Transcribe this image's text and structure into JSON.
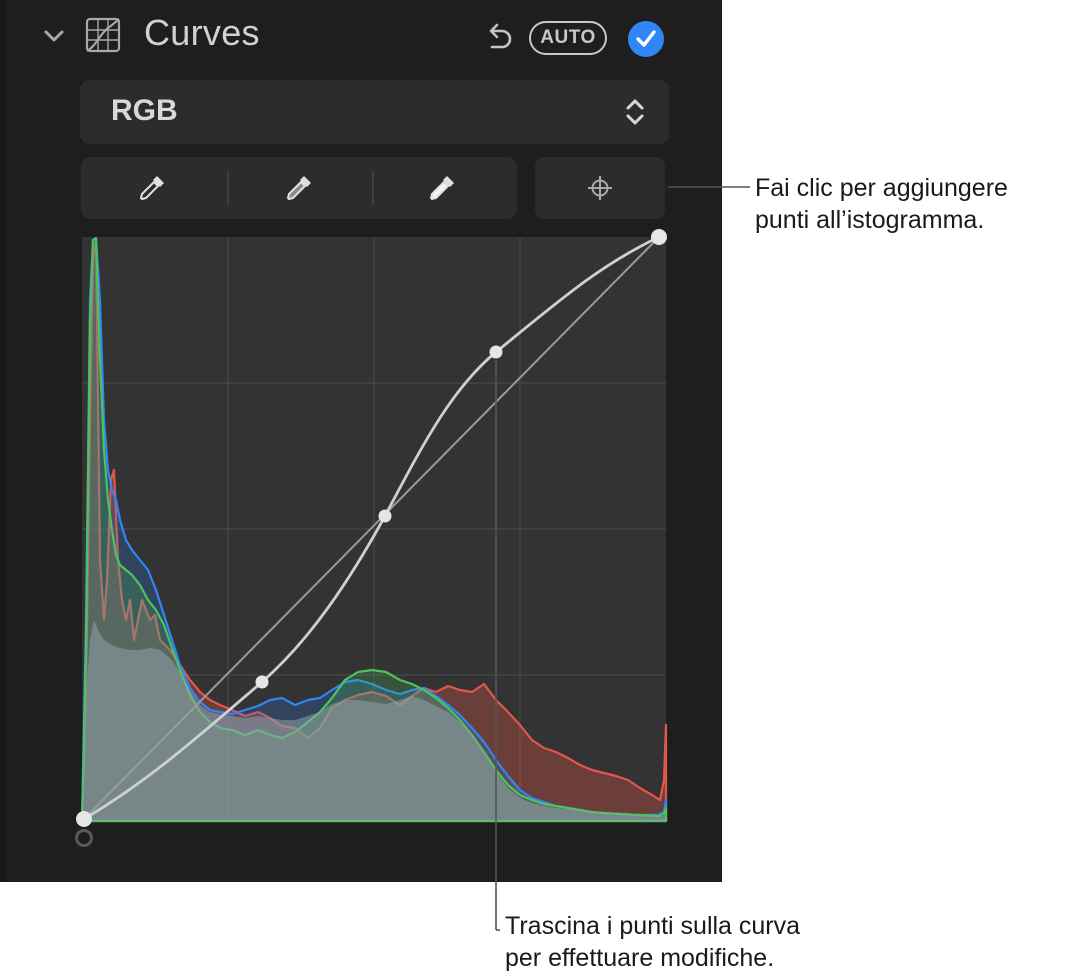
{
  "header": {
    "title": "Curves",
    "auto_label": "AUTO"
  },
  "channel_select": {
    "value": "RGB"
  },
  "callouts": {
    "add_points": {
      "line1": "Fai clic per aggiungere",
      "line2": "punti all’istogramma."
    },
    "drag_points": {
      "line1": "Trascina i punti sulla curva",
      "line2": "per effettuare modifiche."
    }
  },
  "icons": {
    "collapse": "chevron-down-icon",
    "section": "curves-icon",
    "undo": "undo-icon",
    "enabled": "checkmark-icon",
    "select": "up-down-chevron-icon",
    "black_point": "eyedropper-icon",
    "mid_point": "eyedropper-icon",
    "white_point": "eyedropper-icon",
    "add_point": "crosshair-icon"
  },
  "colors": {
    "accent": "#2f86f5",
    "red_channel": "#e2574c",
    "green_channel": "#4cc35d",
    "blue_channel": "#2f86f5"
  }
}
